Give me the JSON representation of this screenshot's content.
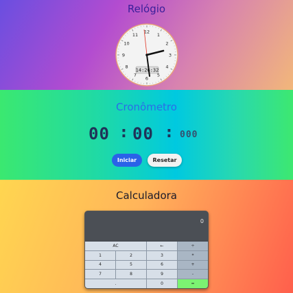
{
  "clock": {
    "title": "Relógio",
    "numerals": [
      "12",
      "1",
      "2",
      "3",
      "4",
      "5",
      "6",
      "7",
      "8",
      "9",
      "10",
      "11"
    ],
    "digital_time": "14:26:32"
  },
  "stopwatch": {
    "title": "Cronômetro",
    "minutes": "00",
    "seconds": "00",
    "milliseconds": "000",
    "separator": ":",
    "start_label": "Iniciar",
    "reset_label": "Resetar"
  },
  "calculator": {
    "title": "Calculadora",
    "display": "0",
    "keys": {
      "ac": "AC",
      "back": "←",
      "divide": "÷",
      "k1": "1",
      "k2": "2",
      "k3": "3",
      "multiply": "*",
      "k4": "4",
      "k5": "5",
      "k6": "6",
      "plus": "+",
      "k7": "7",
      "k8": "8",
      "k9": "9",
      "minus": "-",
      "dot": ".",
      "k0": "0",
      "equals": "="
    }
  },
  "colors": {
    "start_button": "#2a62e8",
    "equals_key": "#7cf272",
    "second_hand": "#e03020"
  }
}
